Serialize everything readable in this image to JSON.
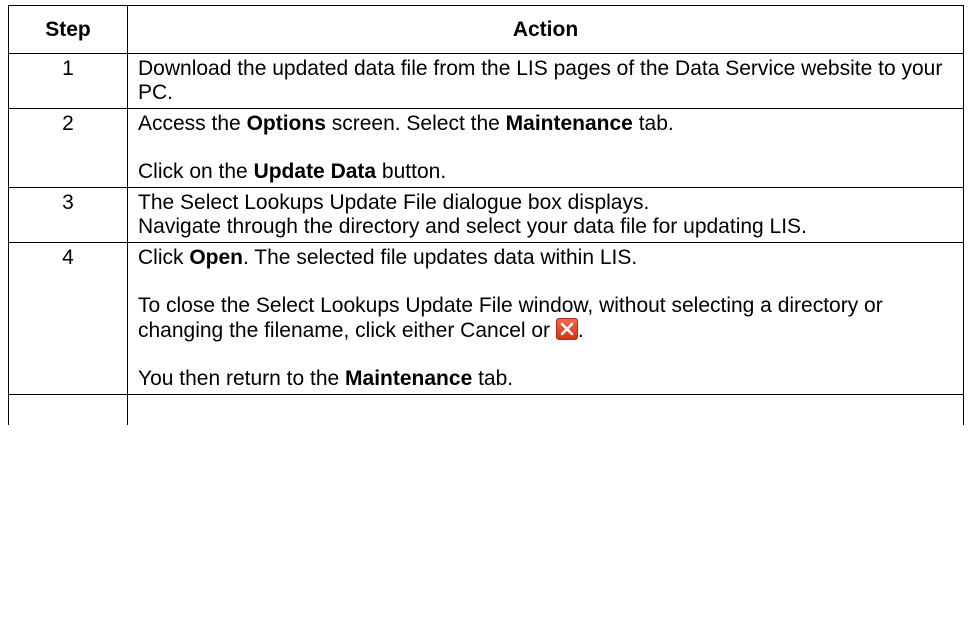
{
  "table": {
    "header": {
      "step": "Step",
      "action": "Action"
    },
    "rows": [
      {
        "num": "1",
        "p1": "Download the updated data file from the LIS pages of the Data Service website to your PC."
      },
      {
        "num": "2",
        "p1_a": "Access the ",
        "p1_b": "Options",
        "p1_c": " screen. Select the ",
        "p1_d": "Maintenance",
        "p1_e": " tab.",
        "p2_a": "Click on the ",
        "p2_b": "Update Data",
        "p2_c": " button."
      },
      {
        "num": "3",
        "p1": "The Select Lookups Update File dialogue box displays.",
        "p2": "Navigate through the directory and select your data file for updating LIS."
      },
      {
        "num": "4",
        "p1_a": "Click ",
        "p1_b": "Open",
        "p1_c": ". The selected file updates data within LIS.",
        "p2_a": "To close the Select Lookups Update File window, without selecting a directory or changing the filename, click either Cancel or ",
        "p2_icon": "close-icon",
        "p2_b": ".",
        "p3_a": "You then return to the ",
        "p3_b": "Maintenance",
        "p3_c": " tab."
      }
    ]
  },
  "colors": {
    "border": "#000000",
    "close_icon": "#e0411f"
  }
}
